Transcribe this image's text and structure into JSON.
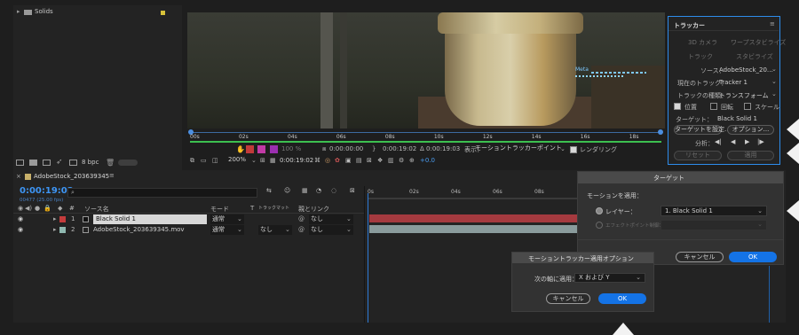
{
  "project": {
    "solids_label": "Solids",
    "bpc": "8 bpc"
  },
  "viewer": {
    "ruler_ticks": [
      "00s",
      "02s",
      "04s",
      "06s",
      "08s",
      "10s",
      "12s",
      "14s",
      "16s",
      "18s"
    ],
    "track_label": "Meta",
    "controls": {
      "opacity": "100 %",
      "time_in": "0:00:00:00",
      "time_out": "0:00:19:02",
      "duration": "Δ 0:00:19:03",
      "view_label": "表示：",
      "view_value": "モーショントラッカーポイント",
      "render_label": "レンダリング",
      "zoom": "200%",
      "timecode": "0:00:19:02",
      "exposure": "+0.0"
    }
  },
  "tracker": {
    "title": "トラッカー",
    "btn_3d_camera": "3D カメラ",
    "btn_warp": "ワープスタビライズ",
    "btn_track": "トラック",
    "btn_stabilize": "スタビライズ",
    "source_label": "ソース：",
    "source_value": "AdobeStock_20…",
    "current_track_label": "現在のトラック：",
    "current_track_value": "Tracker 1",
    "track_type_label": "トラックの種類：",
    "track_type_value": "トランスフォーム",
    "position_label": "位置",
    "rotation_label": "回転",
    "scale_label": "スケール",
    "target_label": "ターゲット：",
    "target_value": "Black Solid 1",
    "set_target_button": "ターゲットを設定...",
    "options_button": "オプション...",
    "analyze_label": "分析：",
    "reset_button": "リセット",
    "apply_button": "適用"
  },
  "timeline": {
    "comp_name": "AdobeStock_203639345",
    "timecode": "0:00:19:02",
    "frame_info": "00477 (25.00 fps)",
    "search_placeholder": "ρ",
    "col_source": "ソース名",
    "col_mode": "モード",
    "col_t": "T",
    "col_trkmat": "トラックマット",
    "col_parent": "親とリンク",
    "col_num": "#",
    "ruler_ticks": [
      "0s",
      "02s",
      "04s",
      "06s",
      "08s"
    ],
    "layers": [
      {
        "num": "1",
        "name": "Black Solid 1",
        "mode": "通常",
        "trkmat": "",
        "parent": "なし",
        "color": "#c43c3c"
      },
      {
        "num": "2",
        "name": "AdobeStock_203639345.mov",
        "mode": "通常",
        "trkmat": "なし",
        "parent": "なし",
        "color": "#8fb8b0"
      }
    ]
  },
  "target_dialog": {
    "title": "ターゲット",
    "section": "モーションを適用：",
    "layer_label": "レイヤー：",
    "layer_value": "1. Black Solid 1",
    "effect_label": "エフェクトポイント制御：",
    "cancel": "キャンセル",
    "ok": "OK"
  },
  "apply_dialog": {
    "title": "モーショントラッカー適用オプション",
    "axis_label": "次の軸に適用：",
    "axis_value": "X および Y",
    "cancel": "キャンセル",
    "ok": "OK"
  },
  "colors": {
    "accent_blue": "#1473e6",
    "highlight_border": "#2d8ceb",
    "work_area_green": "#3cbf4f",
    "layer1_bar": "#a53a3f",
    "layer2_bar": "#8a9b9c"
  }
}
